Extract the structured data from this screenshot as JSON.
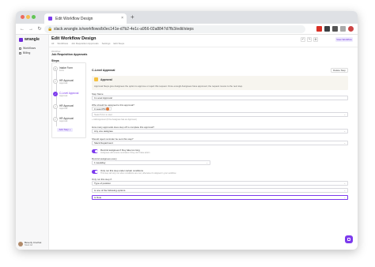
{
  "browser": {
    "tab_title": "Edit Workflow Design",
    "new_tab": "+",
    "tab_close": "×",
    "url": "slack.wrangle.io/workflows/b0ec141e-d7b2-4e1c-a956-02a8847d7fb3/edit/steps",
    "colors": {
      "red": "#ed6a5e",
      "yellow": "#f5bf4f",
      "green": "#61c554"
    }
  },
  "sidebar": {
    "logo": "wrangle",
    "items": [
      {
        "label": "Workflows",
        "icon": "workflow-icon"
      },
      {
        "label": "Billing",
        "icon": "billing-icon"
      }
    ],
    "user": {
      "name": "Beverly Crochet",
      "role": "Slack Ad"
    }
  },
  "header": {
    "title": "Edit Workflow Design",
    "breadcrumbs": [
      "All",
      "Workflows",
      "Job Requisition Approvals",
      "Settings",
      "Edit Steps"
    ],
    "view_button": "View Workflow"
  },
  "workflow": {
    "label": "Workflow",
    "name": "Job Requisition Approvals"
  },
  "steps": {
    "heading": "Steps",
    "items": [
      {
        "name": "Intake Form",
        "sub": "Form",
        "icon": "form-icon"
      },
      {
        "name": "HR Approval",
        "sub": "Approval",
        "icon": "check-icon"
      },
      {
        "name": "C-Level Approval",
        "sub": "Approval",
        "icon": "check-icon",
        "active": true
      },
      {
        "name": "HR Approval",
        "sub": "Approval",
        "icon": "check-icon"
      },
      {
        "name": "HR Approval",
        "sub": "Approval",
        "icon": "check-icon"
      }
    ],
    "add_step": "Add Step +"
  },
  "panel": {
    "title": "C-Level Approval",
    "delete_button": "Delete Step",
    "approval_title": "Approval",
    "approval_desc": "Approval Steps give Assignees the option to approve or reject this request. Once enough Assignees have approved, the request moves to the next step.",
    "step_name_label": "Step Name",
    "step_name_value": "C-Level Approval",
    "assign_label": "Who should be assigned to this approval?",
    "assignee": "C Level PM",
    "assign_placeholder": "Search for a user",
    "assign_hint": "+ Add Approver (If the Assignee has an Approver)",
    "approvals_label": "How many approvals does step off to complete this approval?",
    "approvals_value": "Any one assignee",
    "reminder_label": "Should reject reminder be sent this step?",
    "reminder_value": "Slack Department",
    "toggle1_label": "Remind assignees if they take too long",
    "toggle1_sub": "Assignees will receive reminders if they don't take action",
    "remind_label": "Remind assignees every",
    "remind_value": "1 weekday",
    "toggle2_label": "Only run this step under certain conditions",
    "toggle2_sub": "This step will only run when conditions are met, otherwise it's skipped in your workflow",
    "condition_label": "Only run this step if:",
    "condition_field": "Type of position",
    "condition_op": "is one of the following options",
    "condition_value": "is Role"
  }
}
